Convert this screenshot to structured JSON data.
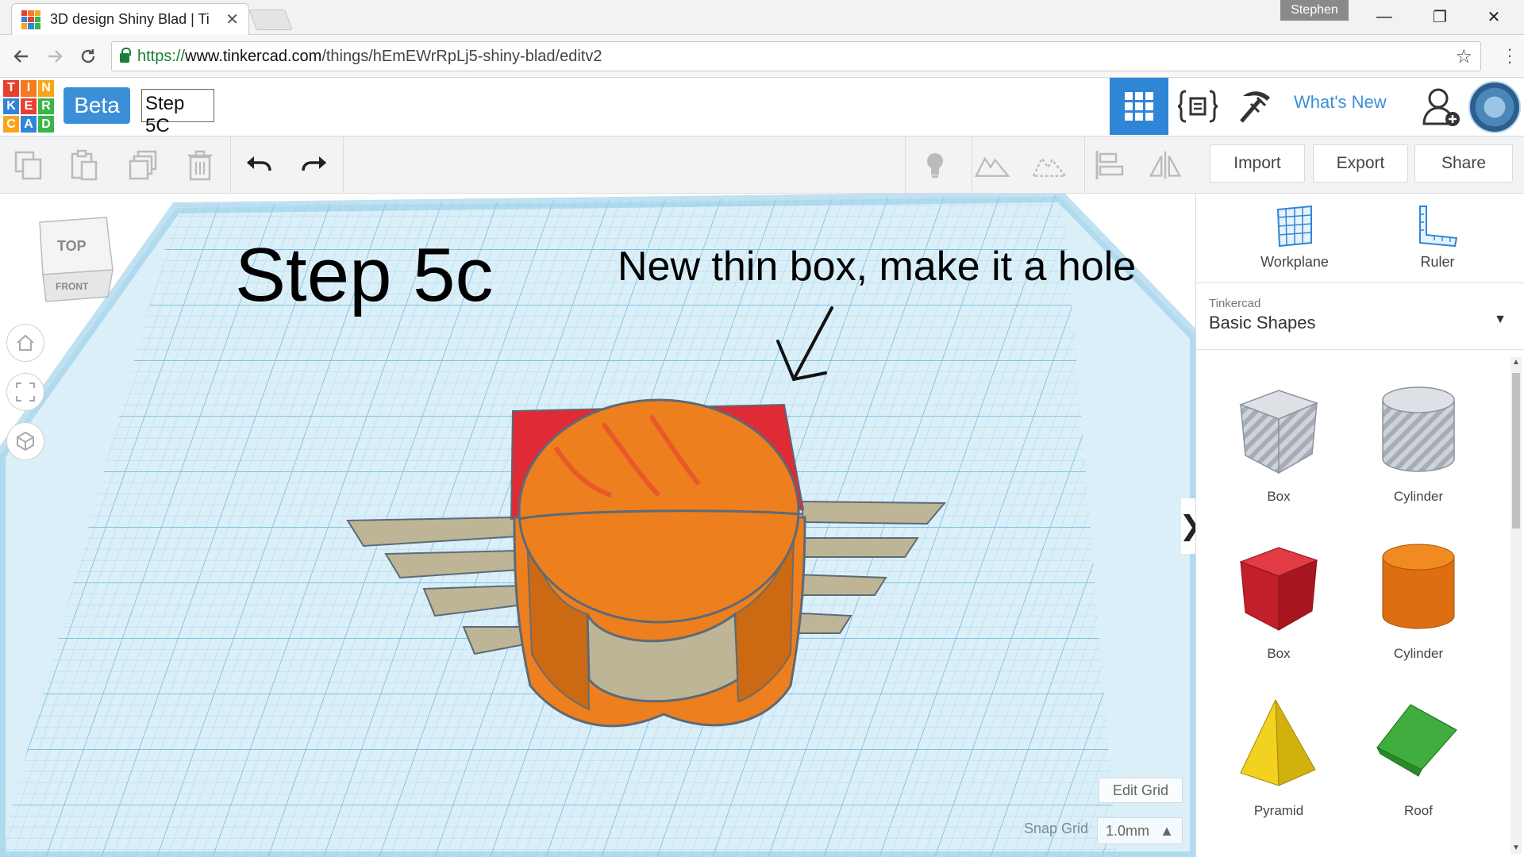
{
  "browser": {
    "tab_title": "3D design Shiny Blad | Ti",
    "tab_close": "✕",
    "profile_name": "Stephen",
    "url_protocol": "https://",
    "url_host": "www.tinkercad.com",
    "url_path": "/things/hEmEWrRpLj5-shiny-blad/editv2",
    "minimize": "—",
    "maximize": "❐",
    "close": "✕"
  },
  "header": {
    "logo_letters": [
      "T",
      "I",
      "N",
      "K",
      "E",
      "R",
      "C",
      "A",
      "D"
    ],
    "logo_colors": [
      "#e8402f",
      "#f47b20",
      "#f9a51a",
      "#2f86d6",
      "#e8402f",
      "#39b54a",
      "#f9a51a",
      "#2f86d6",
      "#39b54a"
    ],
    "beta_label": "Beta",
    "design_name": "Step 5C",
    "whats_new": "What's New"
  },
  "toolbar": {
    "import_label": "Import",
    "export_label": "Export",
    "share_label": "Share"
  },
  "viewport": {
    "step_title": "Step 5c",
    "annotation": "New thin box, make it a hole",
    "viewcube_top": "TOP",
    "viewcube_front": "FRONT",
    "edit_grid_label": "Edit Grid",
    "snap_grid_label": "Snap Grid",
    "snap_grid_value": "1.0mm",
    "panel_toggle": "❯",
    "colors": {
      "grid_bg": "#d9eef8",
      "grid_line": "#7cc3e4",
      "red_box": "#e02a35",
      "orange": "#ee7f1e",
      "tan": "#bfb89a"
    }
  },
  "panel": {
    "workplane_label": "Workplane",
    "ruler_label": "Ruler",
    "library_source": "Tinkercad",
    "library_name": "Basic Shapes",
    "library_caret": "▼",
    "shapes": [
      {
        "label": "Box",
        "icon": "box-hole-icon"
      },
      {
        "label": "Cylinder",
        "icon": "cylinder-hole-icon"
      },
      {
        "label": "Box",
        "icon": "box-solid-icon"
      },
      {
        "label": "Cylinder",
        "icon": "cylinder-solid-icon"
      },
      {
        "label": "Pyramid",
        "icon": "pyramid-icon"
      },
      {
        "label": "Roof",
        "icon": "roof-icon"
      }
    ]
  }
}
